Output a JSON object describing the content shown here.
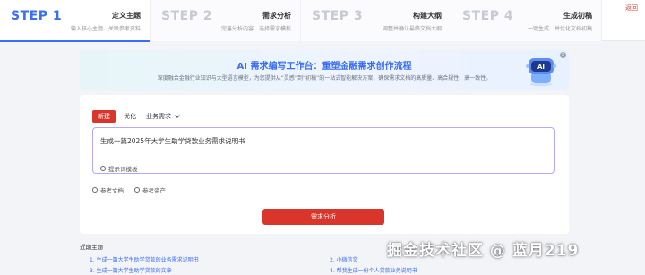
{
  "steps": [
    {
      "num": "STEP 1",
      "title": "定义主题",
      "desc": "输入核心主题、关联参考资料"
    },
    {
      "num": "STEP 2",
      "title": "需求分析",
      "desc": "完善分析内容、选择需求模板"
    },
    {
      "num": "STEP 3",
      "title": "构建大纲",
      "desc": "调整并确认最终文档大纲"
    },
    {
      "num": "STEP 4",
      "title": "生成初稿",
      "desc": "一键生成、并优化文档初稿"
    }
  ],
  "header": {
    "back_label": "返回"
  },
  "banner": {
    "title": "AI 需求编写工作台：重塑金融需求创作流程",
    "subtitle": "深度融合金融行业知识与大型语言模型，为您提供从“灵感”到“初稿”的一站式智能解决方案，确保需求文档的高质量、高合规性、高一致性。",
    "close_glyph": "×",
    "robot_label": "AI"
  },
  "composer": {
    "tabs": [
      "新建",
      "优化"
    ],
    "type_select": "业务需求",
    "prompt_text": "生成一篇2025年大学生助学贷款业务需求说明书",
    "template_hint": "提示词模板",
    "refs": [
      "参考文档",
      "参考资产"
    ],
    "submit_label": "需求分析"
  },
  "recent": {
    "title": "近期主题",
    "items": [
      "1. 生成一篇大学生助学贷款的业务需求说明书",
      "2. 小微信贷",
      "3. 生成一篇大学生助学贷款的文章",
      "4. 帮我生成一份个人贷款业务说明书"
    ]
  },
  "watermark": "掘金技术社区 @ 蓝月219",
  "colors": {
    "accent": "#3b6ef5",
    "primary_red": "#d9352b",
    "prompt_border": "#b7a7ff"
  }
}
